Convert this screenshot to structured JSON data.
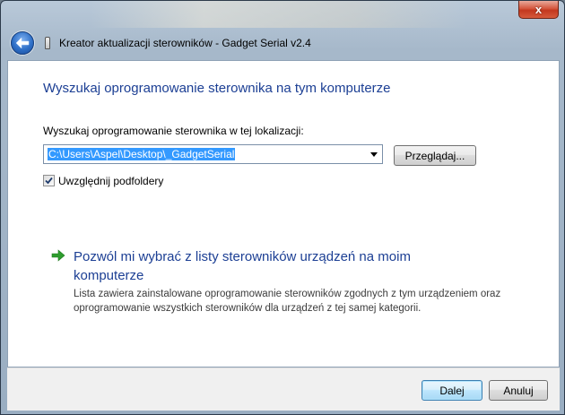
{
  "window": {
    "title": "Kreator aktualizacji sterowników - Gadget Serial v2.4",
    "close_label": "x"
  },
  "icons": {
    "back": "back-arrow-icon",
    "usb": "usb-device-icon",
    "link_arrow": "green-arrow-icon",
    "check": "checkmark-icon"
  },
  "main": {
    "heading": "Wyszukaj oprogramowanie sterownika na tym komputerze",
    "location_label": "Wyszukaj oprogramowanie sterownika w tej lokalizacji:",
    "location_value": "C:\\Users\\Aspel\\Desktop\\_GadgetSerial",
    "browse_label": "Przeglądaj...",
    "include_subfolders_label": "Uwzględnij podfoldery",
    "include_subfolders_checked": true,
    "pick_link_title": "Pozwól mi wybrać z listy sterowników urządzeń na moim komputerze",
    "pick_link_description": "Lista zawiera zainstalowane oprogramowanie sterowników zgodnych z tym urządzeniem oraz oprogramowanie wszystkich sterowników dla urządzeń z tej samej kategorii."
  },
  "footer": {
    "next_label": "Dalej",
    "cancel_label": "Anuluj"
  },
  "colors": {
    "heading": "#1c3f94",
    "selection": "#3399ff",
    "link_arrow": "#2e9d2e",
    "close_button": "#c2381f"
  }
}
